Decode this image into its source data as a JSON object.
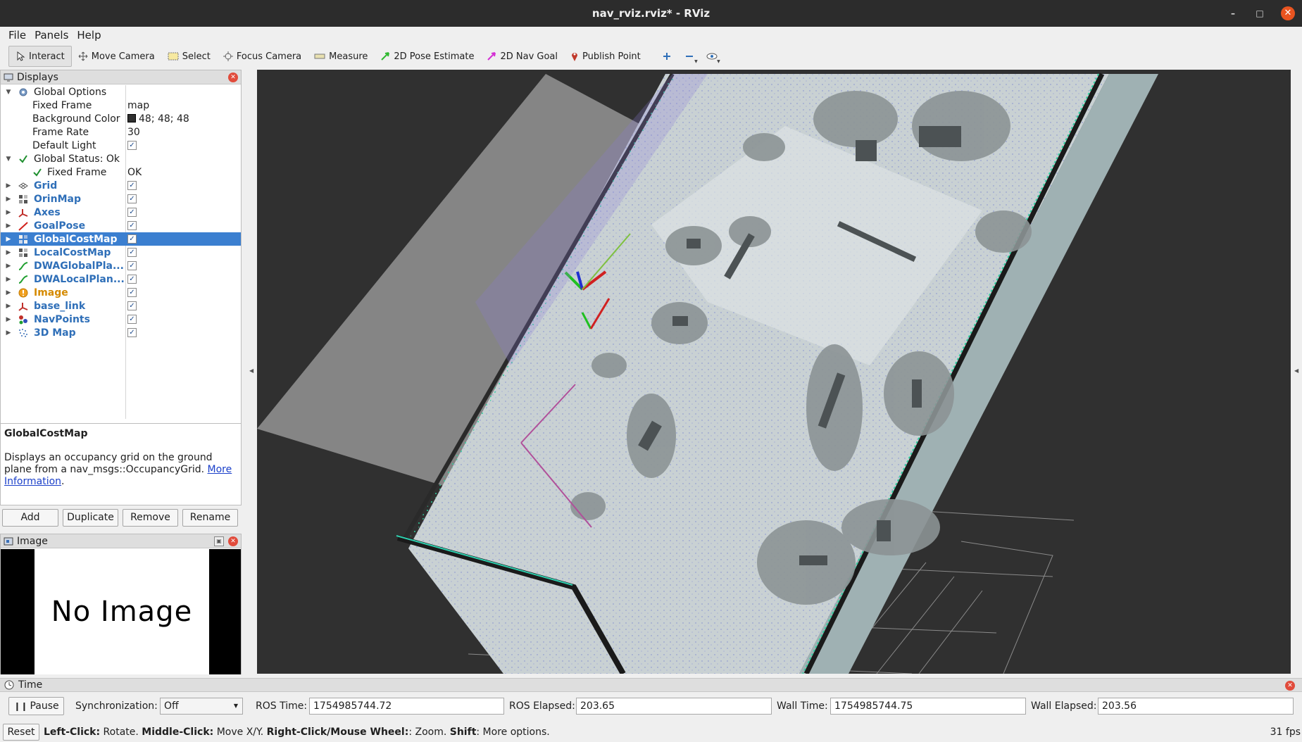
{
  "window": {
    "title": "nav_rviz.rviz* - RViz"
  },
  "menu": {
    "file": "File",
    "panels": "Panels",
    "help": "Help"
  },
  "toolbar": {
    "interact": "Interact",
    "move_camera": "Move Camera",
    "select": "Select",
    "focus_camera": "Focus Camera",
    "measure": "Measure",
    "pose_estimate": "2D Pose Estimate",
    "nav_goal": "2D Nav Goal",
    "publish_point": "Publish Point"
  },
  "displays": {
    "title": "Displays",
    "global_options": {
      "label": "Global Options",
      "fixed_frame_label": "Fixed Frame",
      "fixed_frame_value": "map",
      "bg_color_label": "Background Color",
      "bg_color_value": "48; 48; 48",
      "frame_rate_label": "Frame Rate",
      "frame_rate_value": "30",
      "default_light_label": "Default Light",
      "default_light_checked": true
    },
    "global_status": {
      "label": "Global Status: Ok",
      "fixed_frame_label": "Fixed Frame",
      "fixed_frame_value": "OK"
    },
    "items": [
      {
        "label": "Grid",
        "icon": "grid-icon",
        "checked": true,
        "color": "blue"
      },
      {
        "label": "OrinMap",
        "icon": "map-icon",
        "checked": true,
        "color": "blue"
      },
      {
        "label": "Axes",
        "icon": "axes-icon",
        "checked": true,
        "color": "blue"
      },
      {
        "label": "GoalPose",
        "icon": "pose-arrow-icon",
        "checked": true,
        "color": "blue"
      },
      {
        "label": "GlobalCostMap",
        "icon": "map-icon",
        "checked": true,
        "color": "blue",
        "selected": true
      },
      {
        "label": "LocalCostMap",
        "icon": "map-icon",
        "checked": true,
        "color": "blue"
      },
      {
        "label": "DWAGlobalPla...",
        "icon": "path-icon",
        "checked": true,
        "color": "blue"
      },
      {
        "label": "DWALocalPlan...",
        "icon": "path-icon",
        "checked": true,
        "color": "blue"
      },
      {
        "label": "Image",
        "icon": "warning-icon",
        "checked": true,
        "color": "orange"
      },
      {
        "label": "base_link",
        "icon": "axes-icon",
        "checked": true,
        "color": "blue"
      },
      {
        "label": "NavPoints",
        "icon": "markers-icon",
        "checked": true,
        "color": "blue"
      },
      {
        "label": "3D Map",
        "icon": "pointcloud-icon",
        "checked": true,
        "color": "blue"
      }
    ],
    "description": {
      "title": "GlobalCostMap",
      "text": "Displays an occupancy grid on the ground plane from a nav_msgs::OccupancyGrid.",
      "link": "More Information",
      "end": "."
    },
    "buttons": {
      "add": "Add",
      "duplicate": "Duplicate",
      "remove": "Remove",
      "rename": "Rename"
    }
  },
  "image_panel": {
    "title": "Image",
    "placeholder": "No Image"
  },
  "time_panel": {
    "title": "Time",
    "pause": "Pause",
    "sync_label": "Synchronization:",
    "sync_value": "Off",
    "ros_time_label": "ROS Time:",
    "ros_time": "1754985744.72",
    "ros_elapsed_label": "ROS Elapsed:",
    "ros_elapsed": "203.65",
    "wall_time_label": "Wall Time:",
    "wall_time": "1754985744.75",
    "wall_elapsed_label": "Wall Elapsed:",
    "wall_elapsed": "203.56"
  },
  "status_bar": {
    "reset": "Reset",
    "k1": "Left-Click:",
    "v1": " Rotate. ",
    "k2": "Middle-Click:",
    "v2": " Move X/Y. ",
    "k3": "Right-Click/Mouse Wheel:",
    "v3": ": Zoom. ",
    "k4": "Shift",
    "v4": ": More options.",
    "fps": "31 fps"
  },
  "colors": {
    "selection": "#3b7fd0",
    "viewport_bg": "#303030",
    "link_blue": "#2f6fb8"
  }
}
